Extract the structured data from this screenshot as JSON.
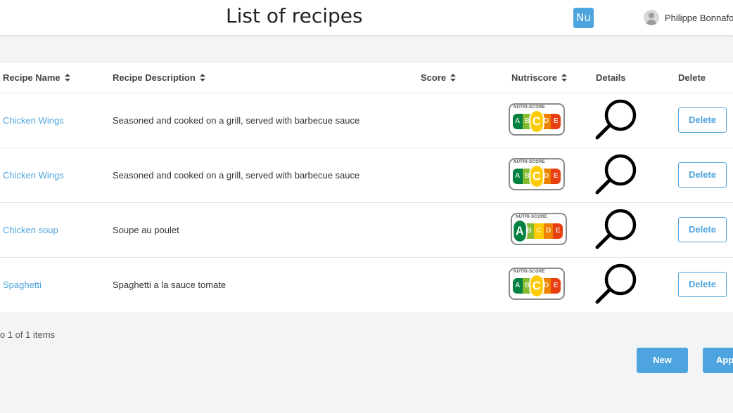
{
  "header": {
    "title": "List of recipes",
    "badge": "Nu",
    "user_name": "Philippe Bonnafou"
  },
  "table": {
    "columns": [
      "Recipe Name",
      "Recipe Description",
      "Score",
      "Nutriscore",
      "Details",
      "Delete"
    ],
    "nutriscore_label": "NUTRI-SCORE",
    "nutriscore_grades": [
      "A",
      "B",
      "C",
      "D",
      "E"
    ],
    "grade_colors": {
      "A": "#038141",
      "B": "#85bb2f",
      "C": "#fecb02",
      "D": "#ee8100",
      "E": "#e63e11"
    },
    "rows": [
      {
        "name": "Chicken Wings",
        "description": "Seasoned and cooked on a grill, served with barbecue sauce",
        "score": "",
        "nutriscore": "C",
        "details_icon": "magnifier-icon",
        "delete_label": "Delete"
      },
      {
        "name": "Chicken Wings",
        "description": "Seasoned and cooked on a grill, served with barbecue sauce",
        "score": "",
        "nutriscore": "C",
        "details_icon": "magnifier-icon",
        "delete_label": "Delete"
      },
      {
        "name": "Chicken soup",
        "description": "Soupe au poulet",
        "score": "",
        "nutriscore": "A",
        "details_icon": "magnifier-icon",
        "delete_label": "Delete"
      },
      {
        "name": "Spaghetti",
        "description": "Spaghetti a la sauce tomate",
        "score": "",
        "nutriscore": "C",
        "details_icon": "magnifier-icon",
        "delete_label": "Delete"
      }
    ]
  },
  "pagination": {
    "text": "o 1 of 1 items"
  },
  "actions": {
    "new_label": "New",
    "apply_label": "App"
  },
  "colors": {
    "accent": "#4ea4de",
    "background": "#f2f4f5"
  }
}
